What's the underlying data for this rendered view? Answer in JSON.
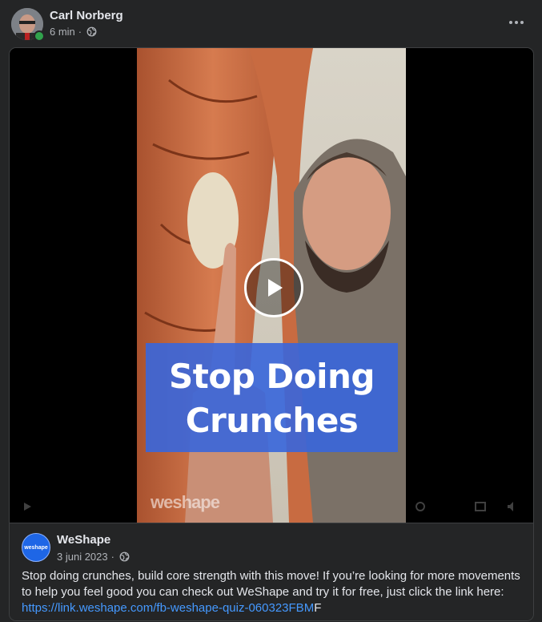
{
  "post": {
    "author": "Carl Norberg",
    "time": "6 min",
    "separator": "·",
    "privacy_icon": "globe-icon",
    "more_icon": "more-options-icon"
  },
  "video": {
    "caption_line1": "Stop Doing",
    "caption_line2": "Crunches",
    "watermark": "weshape",
    "play_icon": "play-icon"
  },
  "shared_post": {
    "page_name": "WeShape",
    "avatar_text": "weshape",
    "date": "3 juni 2023",
    "separator": "·",
    "text_before_link": "Stop doing crunches, build core strength with this move! If you’re looking for more movements to help you feel good you can check out WeShape and try it for free, just click the link here: ",
    "link_text": "https://link.weshape.com/fb-weshape-quiz-060323FBM",
    "text_after_link": "F"
  },
  "colors": {
    "background": "#242526",
    "online": "#31a24c",
    "link": "#4599ff",
    "caption_box": "#3966dc"
  }
}
